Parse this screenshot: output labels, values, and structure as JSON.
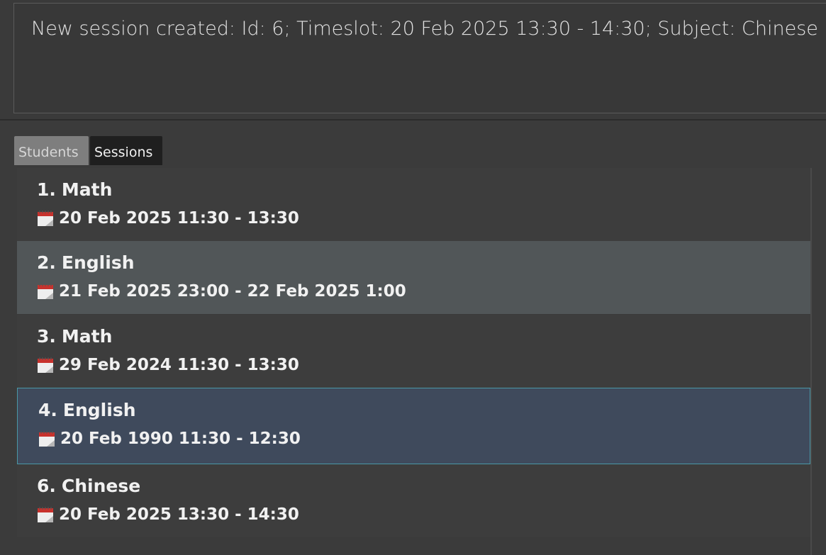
{
  "result_display": {
    "message": "New session created: Id: 6; Timeslot: 20 Feb 2025 13:30 - 14:30; Subject: Chinese"
  },
  "tabs": [
    {
      "label": "Students",
      "selected": false
    },
    {
      "label": "Sessions",
      "selected": true
    }
  ],
  "sessions": [
    {
      "number": "1.",
      "subject": "Math",
      "timeslot": "20 Feb 2025 11:30 - 13:30",
      "icon": "calendar-icon"
    },
    {
      "number": "2.",
      "subject": "English",
      "timeslot": "21 Feb 2025 23:00 - 22 Feb 2025 1:00",
      "icon": "calendar-icon"
    },
    {
      "number": "3.",
      "subject": "Math",
      "timeslot": "29 Feb 2024 11:30 - 13:30",
      "icon": "calendar-icon"
    },
    {
      "number": "4.",
      "subject": "English",
      "timeslot": "20 Feb 1990 11:30 - 12:30",
      "icon": "calendar-icon",
      "selected": true
    },
    {
      "number": "6.",
      "subject": "Chinese",
      "timeslot": "20 Feb 2025 13:30 - 14:30",
      "icon": "calendar-icon"
    }
  ],
  "colors": {
    "background": "#3b3b3b",
    "row_alt": "#515658",
    "row_selected": "#3f4a5c",
    "selected_border": "#4a98a6",
    "tab_active": "#1f1f1f",
    "tab_inactive": "#7e7e7e"
  }
}
